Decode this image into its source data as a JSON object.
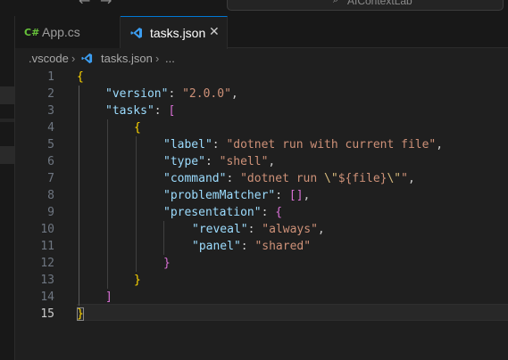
{
  "titlebar": {
    "back_icon": "arrow-left-icon",
    "forward_icon": "arrow-right-icon",
    "search_text": "AIContextLab"
  },
  "tabs": [
    {
      "label": "App.cs",
      "icon": "csharp-icon",
      "icon_text": "C#",
      "active": false
    },
    {
      "label": "tasks.json",
      "icon": "vscode-json-icon",
      "active": true,
      "close_glyph": "✕"
    }
  ],
  "breadcrumb": {
    "items": [
      ".vscode",
      "tasks.json",
      "..."
    ],
    "separator": "›"
  },
  "editor": {
    "line_numbers": [
      "1",
      "2",
      "3",
      "4",
      "5",
      "6",
      "7",
      "8",
      "9",
      "10",
      "11",
      "12",
      "13",
      "14",
      "15"
    ],
    "current_line": "15",
    "code": {
      "l1_open": "{",
      "version_key": "\"version\"",
      "version_val": "\"2.0.0\"",
      "tasks_key": "\"tasks\"",
      "tasks_open": "[",
      "task_open": "{",
      "label_key": "\"label\"",
      "label_val": "\"dotnet run with current file\"",
      "type_key": "\"type\"",
      "type_val": "\"shell\"",
      "command_key": "\"command\"",
      "command_val_a": "\"dotnet run ",
      "command_esc_a": "\\\"",
      "command_val_b": "${file}",
      "command_esc_b": "\\\"",
      "command_val_c": "\"",
      "problem_key": "\"problemMatcher\"",
      "problem_val": "[]",
      "presentation_key": "\"presentation\"",
      "presentation_open": "{",
      "reveal_key": "\"reveal\"",
      "reveal_val": "\"always\"",
      "panel_key": "\"panel\"",
      "panel_val": "\"shared\"",
      "presentation_close": "}",
      "task_close": "}",
      "tasks_close": "]",
      "l15_close": "}"
    }
  },
  "colors": {
    "accent": "#0078d4",
    "json_key": "#9cdcfe",
    "json_string": "#ce9178",
    "bracket_level1": "#ffd700",
    "bracket_level2": "#da70d6",
    "bracket_level3": "#179fff"
  }
}
